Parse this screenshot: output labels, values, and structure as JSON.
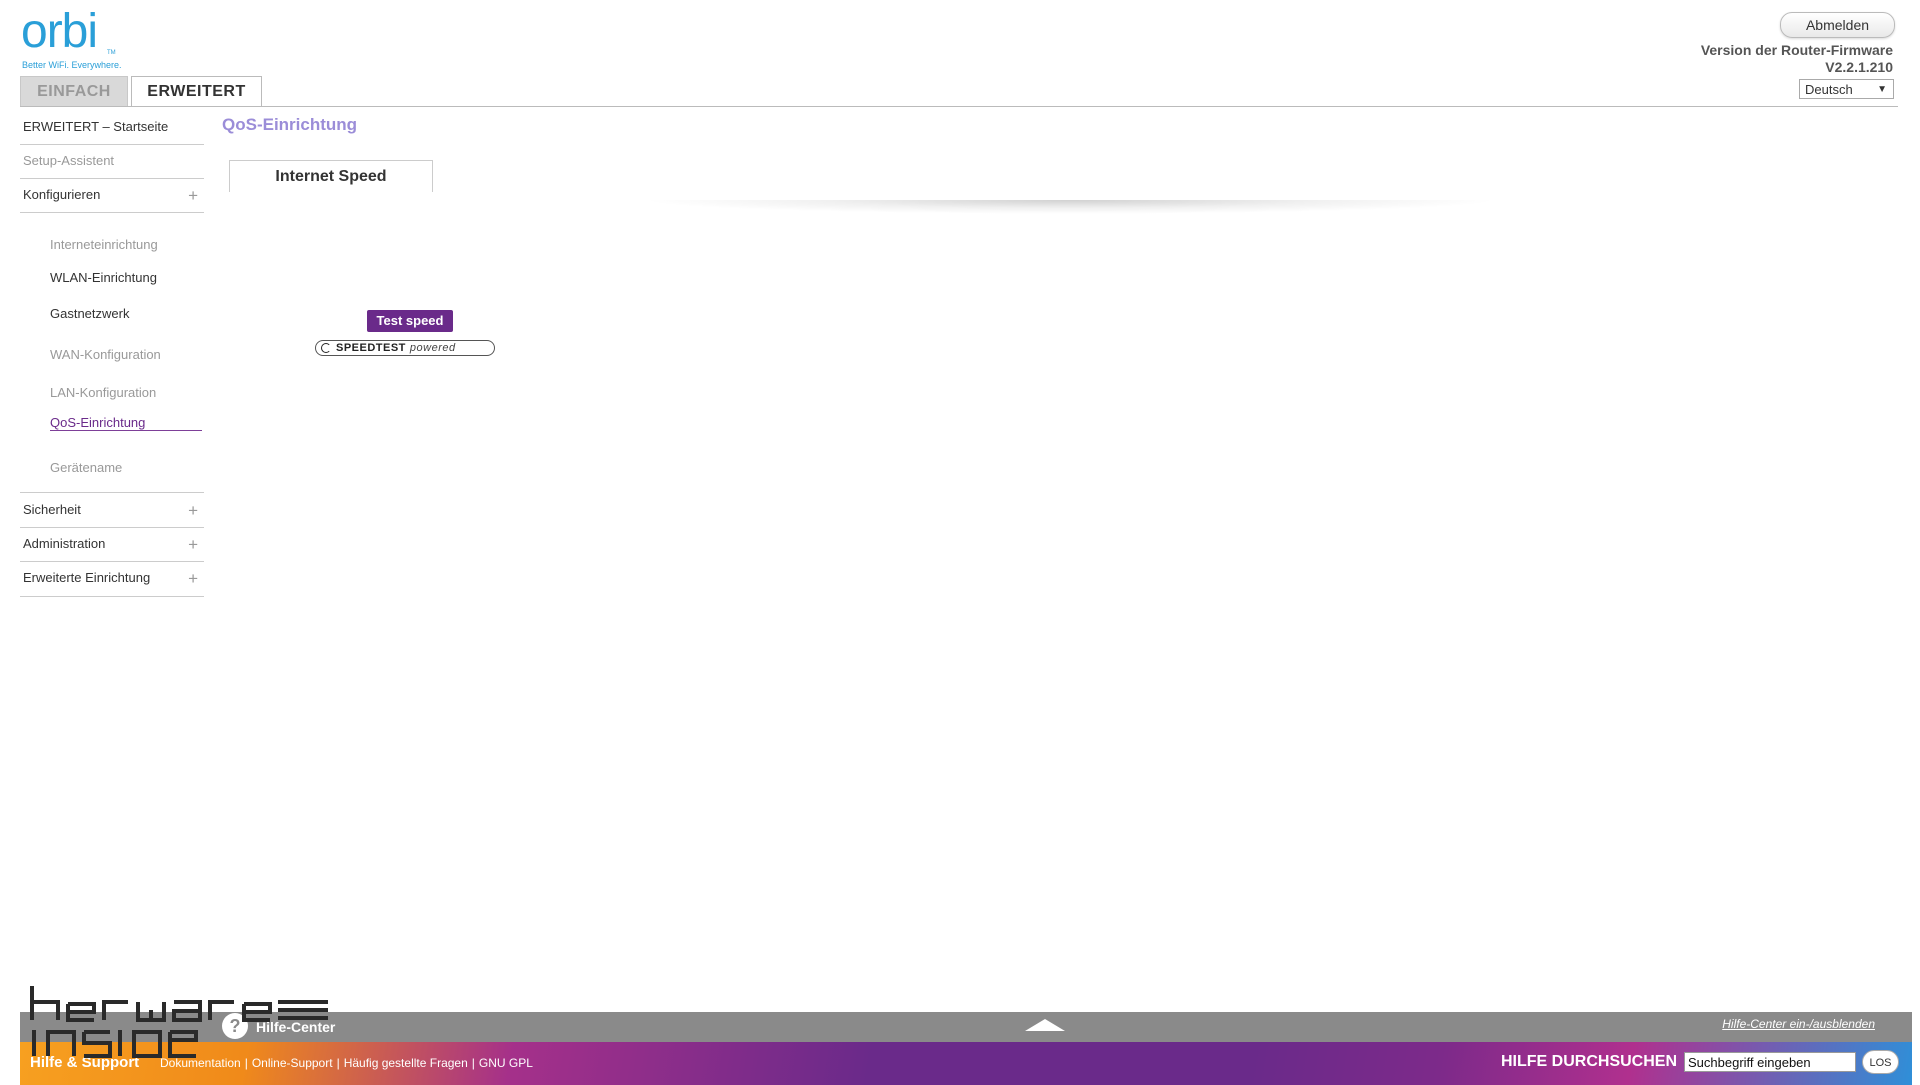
{
  "brand": {
    "logo_text": "orbi",
    "logo_tm": "TM",
    "tagline": "Better WiFi. Everywhere."
  },
  "header": {
    "logout_label": "Abmelden",
    "firmware_label": "Version der Router-Firmware",
    "firmware_version": "V2.2.1.210",
    "language": "Deutsch"
  },
  "tabs": {
    "simple": "EINFACH",
    "advanced": "ERWEITERT"
  },
  "sidebar": {
    "home": "ERWEITERT – Startseite",
    "setup_wizard": "Setup-Assistent",
    "configure": "Konfigurieren",
    "sub": {
      "internet": "Interneteinrichtung",
      "wlan": "WLAN-Einrichtung",
      "guest": "Gastnetzwerk",
      "wan": "WAN-Konfiguration",
      "lan": "LAN-Konfiguration",
      "qos": "QoS-Einrichtung",
      "device_name": "Gerätename"
    },
    "security": "Sicherheit",
    "administration": "Administration",
    "advanced_setup": "Erweiterte Einrichtung"
  },
  "main": {
    "title": "QoS-Einrichtung",
    "subtab": "Internet Speed",
    "test_button": "Test speed",
    "speedtest_brand": "SPEEDTEST",
    "speedtest_powered": "powered"
  },
  "help_center": {
    "title": "Hilfe-Center",
    "toggle": "Hilfe-Center ein-/ausblenden"
  },
  "support": {
    "title": "Hilfe & Support",
    "links": [
      "Dokumentation",
      "Online-Support",
      "Häufig gestellte Fragen",
      "GNU GPL"
    ],
    "search_title": "HILFE DURCHSUCHEN",
    "search_value": "Suchbegriff eingeben",
    "search_button": "LOS"
  },
  "colors": {
    "accent_purple": "#6a2a8a",
    "title_lavender": "#9b8dd8",
    "brand_blue": "#2a9fd8"
  }
}
